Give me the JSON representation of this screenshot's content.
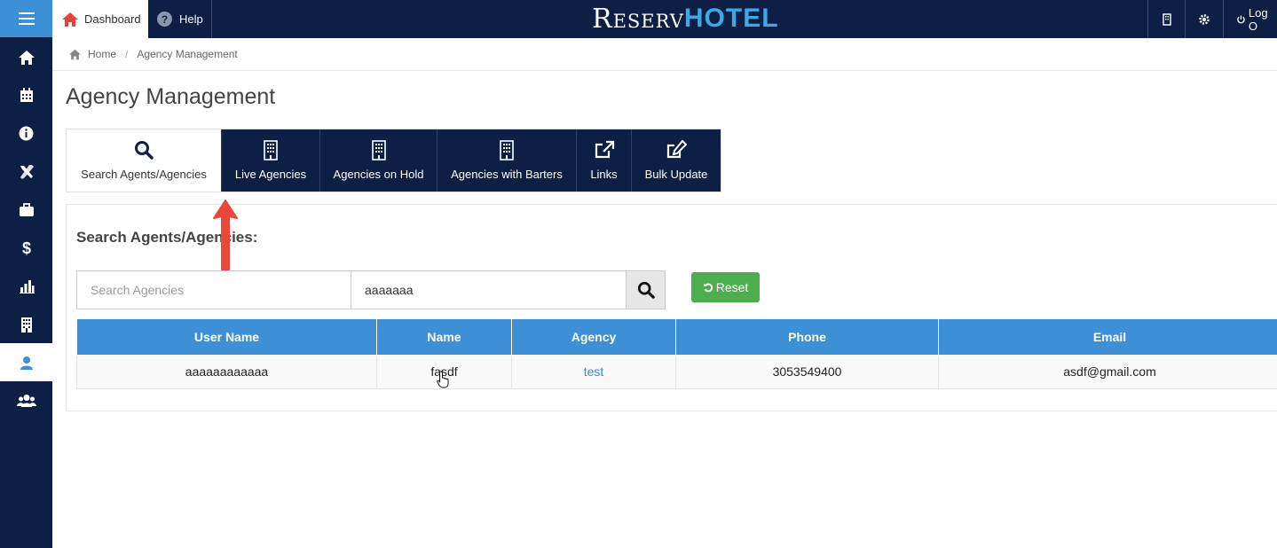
{
  "topbar": {
    "dashboard_label": "Dashboard",
    "help_label": "Help",
    "help_glyph": "?",
    "logo_reserv": "Reserv",
    "logo_hotel": "HOTEL",
    "logout_label": "Log O"
  },
  "sidebar": {
    "items": [
      {
        "icon": "home-icon"
      },
      {
        "icon": "calendar-icon"
      },
      {
        "icon": "info-icon"
      },
      {
        "icon": "tools-icon"
      },
      {
        "icon": "briefcase-icon"
      },
      {
        "icon": "dollar-icon"
      },
      {
        "icon": "bar-chart-icon"
      },
      {
        "icon": "building-icon"
      },
      {
        "icon": "user-icon",
        "active": true
      },
      {
        "icon": "users-icon"
      }
    ]
  },
  "breadcrumb": {
    "home": "Home",
    "separator": "/",
    "current": "Agency Management"
  },
  "page": {
    "title": "Agency Management"
  },
  "tabs": [
    {
      "label": "Search Agents/Agencies",
      "icon": "search-icon",
      "active": true
    },
    {
      "label": "Live Agencies",
      "icon": "building-icon"
    },
    {
      "label": "Agencies on Hold",
      "icon": "building-icon"
    },
    {
      "label": "Agencies with Barters",
      "icon": "building-icon"
    },
    {
      "label": "Links",
      "icon": "external-link-icon"
    },
    {
      "label": "Bulk Update",
      "icon": "edit-icon"
    }
  ],
  "search": {
    "heading": "Search Agents/Agencies:",
    "placeholder": "Search Agencies",
    "value": "aaaaaaa",
    "reset_label": "Reset"
  },
  "table": {
    "columns": [
      "User Name",
      "Name",
      "Agency",
      "Phone",
      "Email"
    ],
    "rows": [
      {
        "user_name": "aaaaaaaaaaaa",
        "name": "fasdf",
        "agency": "test",
        "phone": "3053549400",
        "email": "asdf@gmail.com"
      }
    ]
  },
  "colors": {
    "navy": "#0d1f45",
    "accent_blue": "#3d8fd6",
    "reset_green": "#4cae4c",
    "annotation_red": "#e8483b"
  }
}
